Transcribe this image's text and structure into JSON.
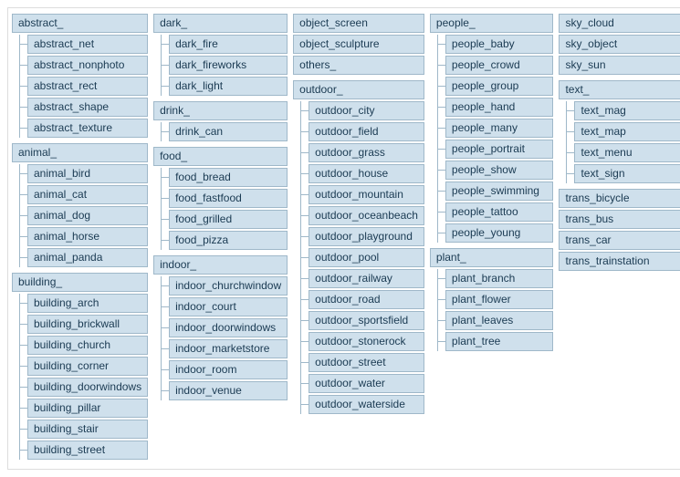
{
  "columns": [
    [
      {
        "kind": "group",
        "label": "abstract_",
        "children": [
          "abstract_net",
          "abstract_nonphoto",
          "abstract_rect",
          "abstract_shape",
          "abstract_texture"
        ]
      },
      {
        "kind": "group",
        "label": "animal_",
        "children": [
          "animal_bird",
          "animal_cat",
          "animal_dog",
          "animal_horse",
          "animal_panda"
        ]
      },
      {
        "kind": "group",
        "label": "building_",
        "children": [
          "building_arch",
          "building_brickwall",
          "building_church",
          "building_corner",
          "building_doorwindows",
          "building_pillar",
          "building_stair",
          "building_street"
        ]
      }
    ],
    [
      {
        "kind": "group",
        "label": "dark_",
        "children": [
          "dark_fire",
          "dark_fireworks",
          "dark_light"
        ]
      },
      {
        "kind": "group",
        "label": "drink_",
        "children": [
          "drink_can"
        ]
      },
      {
        "kind": "group",
        "label": "food_",
        "children": [
          "food_bread",
          "food_fastfood",
          "food_grilled",
          "food_pizza"
        ]
      },
      {
        "kind": "group",
        "label": "indoor_",
        "children": [
          "indoor_churchwindow",
          "indoor_court",
          "indoor_doorwindows",
          "indoor_marketstore",
          "indoor_room",
          "indoor_venue"
        ]
      }
    ],
    [
      {
        "kind": "flat",
        "items": [
          "object_screen",
          "object_sculpture",
          "others_"
        ]
      },
      {
        "kind": "group",
        "label": "outdoor_",
        "children": [
          "outdoor_city",
          "outdoor_field",
          "outdoor_grass",
          "outdoor_house",
          "outdoor_mountain",
          "outdoor_oceanbeach",
          "outdoor_playground",
          "outdoor_pool",
          "outdoor_railway",
          "outdoor_road",
          "outdoor_sportsfield",
          "outdoor_stonerock",
          "outdoor_street",
          "outdoor_water",
          "outdoor_waterside"
        ]
      }
    ],
    [
      {
        "kind": "group",
        "label": "people_",
        "children": [
          "people_baby",
          "people_crowd",
          "people_group",
          "people_hand",
          "people_many",
          "people_portrait",
          "people_show",
          "people_swimming",
          "people_tattoo",
          "people_young"
        ]
      },
      {
        "kind": "group",
        "label": "plant_",
        "children": [
          "plant_branch",
          "plant_flower",
          "plant_leaves",
          "plant_tree"
        ]
      }
    ],
    [
      {
        "kind": "flat",
        "items": [
          "sky_cloud",
          "sky_object",
          "sky_sun"
        ]
      },
      {
        "kind": "group",
        "label": "text_",
        "children": [
          "text_mag",
          "text_map",
          "text_menu",
          "text_sign"
        ]
      },
      {
        "kind": "flat",
        "items": [
          "trans_bicycle",
          "trans_bus",
          "trans_car",
          "trans_trainstation"
        ]
      }
    ]
  ]
}
